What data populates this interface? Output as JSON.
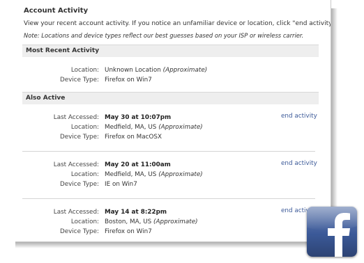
{
  "title": "Account Activity",
  "intro": "View your recent account activity. If you notice an unfamiliar device or location, click \"end activity\"",
  "note": "Note: Locations and device types reflect our best guesses based on your ISP or wireless carrier.",
  "most_recent": {
    "heading": "Most Recent Activity",
    "location_label": "Location:",
    "location_value": "Unknown Location",
    "location_approx": "(Approximate)",
    "device_label": "Device Type:",
    "device_value": "Firefox on Win7"
  },
  "also_active": {
    "heading": "Also Active",
    "entries": [
      {
        "accessed_label": "Last Accessed:",
        "accessed_value": "May 30 at 10:07pm",
        "location_label": "Location:",
        "location_value": "Medfield, MA, US",
        "location_approx": "(Approximate)",
        "device_label": "Device Type:",
        "device_value": "Firefox on MacOSX",
        "end_label": "end activity"
      },
      {
        "accessed_label": "Last Accessed:",
        "accessed_value": "May 20 at 11:00am",
        "location_label": "Location:",
        "location_value": "Medfield, MA, US",
        "location_approx": "(Approximate)",
        "device_label": "Device Type:",
        "device_value": "IE on Win7",
        "end_label": "end activity"
      },
      {
        "accessed_label": "Last Accessed:",
        "accessed_value": "May 14 at 8:22pm",
        "location_label": "Location:",
        "location_value": "Boston, MA, US",
        "location_approx": "(Approximate)",
        "device_label": "Device Type:",
        "device_value": "Firefox on Win7",
        "end_label": "end activit"
      }
    ]
  },
  "logo": {
    "icon": "facebook-logo-icon",
    "glyph": "f",
    "color": "#3b5998"
  },
  "colors": {
    "link": "#3b5998",
    "section_bg": "#eeeeee"
  }
}
